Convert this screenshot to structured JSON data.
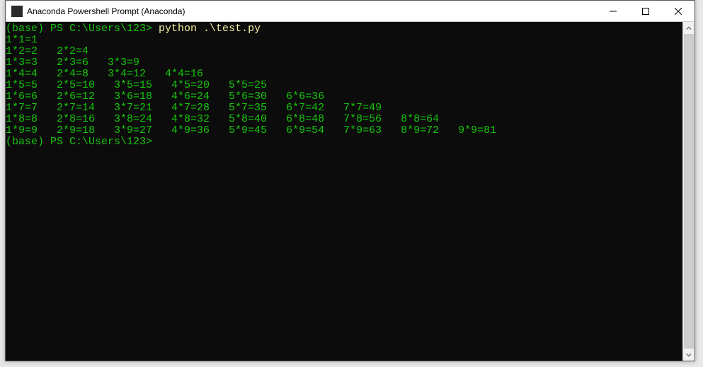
{
  "window": {
    "title": "Anaconda Powershell Prompt (Anaconda)"
  },
  "terminal": {
    "prompt1_prefix": "(base) PS C:\\Users\\123> ",
    "command": "python .\\test.py",
    "output_lines": [
      "1*1=1",
      "1*2=2   2*2=4",
      "1*3=3   2*3=6   3*3=9",
      "1*4=4   2*4=8   3*4=12   4*4=16",
      "1*5=5   2*5=10   3*5=15   4*5=20   5*5=25",
      "1*6=6   2*6=12   3*6=18   4*6=24   5*6=30   6*6=36",
      "1*7=7   2*7=14   3*7=21   4*7=28   5*7=35   6*7=42   7*7=49",
      "1*8=8   2*8=16   3*8=24   4*8=32   5*8=40   6*8=48   7*8=56   8*8=64",
      "1*9=9   2*9=18   3*9=27   4*9=36   5*9=45   6*9=54   7*9=63   8*9=72   9*9=81"
    ],
    "prompt2": "(base) PS C:\\Users\\123>"
  }
}
